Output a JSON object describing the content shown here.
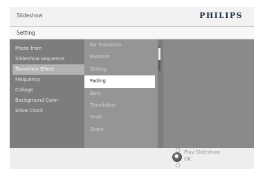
{
  "header": {
    "title": "Slideshow",
    "brand": "PHILIPS"
  },
  "breadcrumb": {
    "label": "Setting"
  },
  "left_menu": {
    "items": [
      {
        "label": "Photo from",
        "selected": false
      },
      {
        "label": "Slideshow sequence",
        "selected": false
      },
      {
        "label": "Transition Effect",
        "selected": true
      },
      {
        "label": "Frequency",
        "selected": false
      },
      {
        "label": "Collage",
        "selected": false
      },
      {
        "label": "Background Color",
        "selected": false
      },
      {
        "label": "Show Clock",
        "selected": false
      }
    ]
  },
  "submenu": {
    "items": [
      {
        "label": "No Transition",
        "selected": false
      },
      {
        "label": "Random",
        "selected": false
      },
      {
        "label": "Sliding",
        "selected": false
      },
      {
        "label": "Fading",
        "selected": true
      },
      {
        "label": "Bars",
        "selected": false
      },
      {
        "label": "Translation",
        "selected": false
      },
      {
        "label": "Snail",
        "selected": false
      },
      {
        "label": "Stairs",
        "selected": false
      }
    ]
  },
  "controls": {
    "play_label": "Play Slideshow",
    "ok_label": "OK",
    "dial_icon": "nav-dial-icon"
  },
  "colors": {
    "brand": "#1f2c43",
    "highlight": "#ffffff",
    "menu_bg": "#7d7d7d"
  }
}
